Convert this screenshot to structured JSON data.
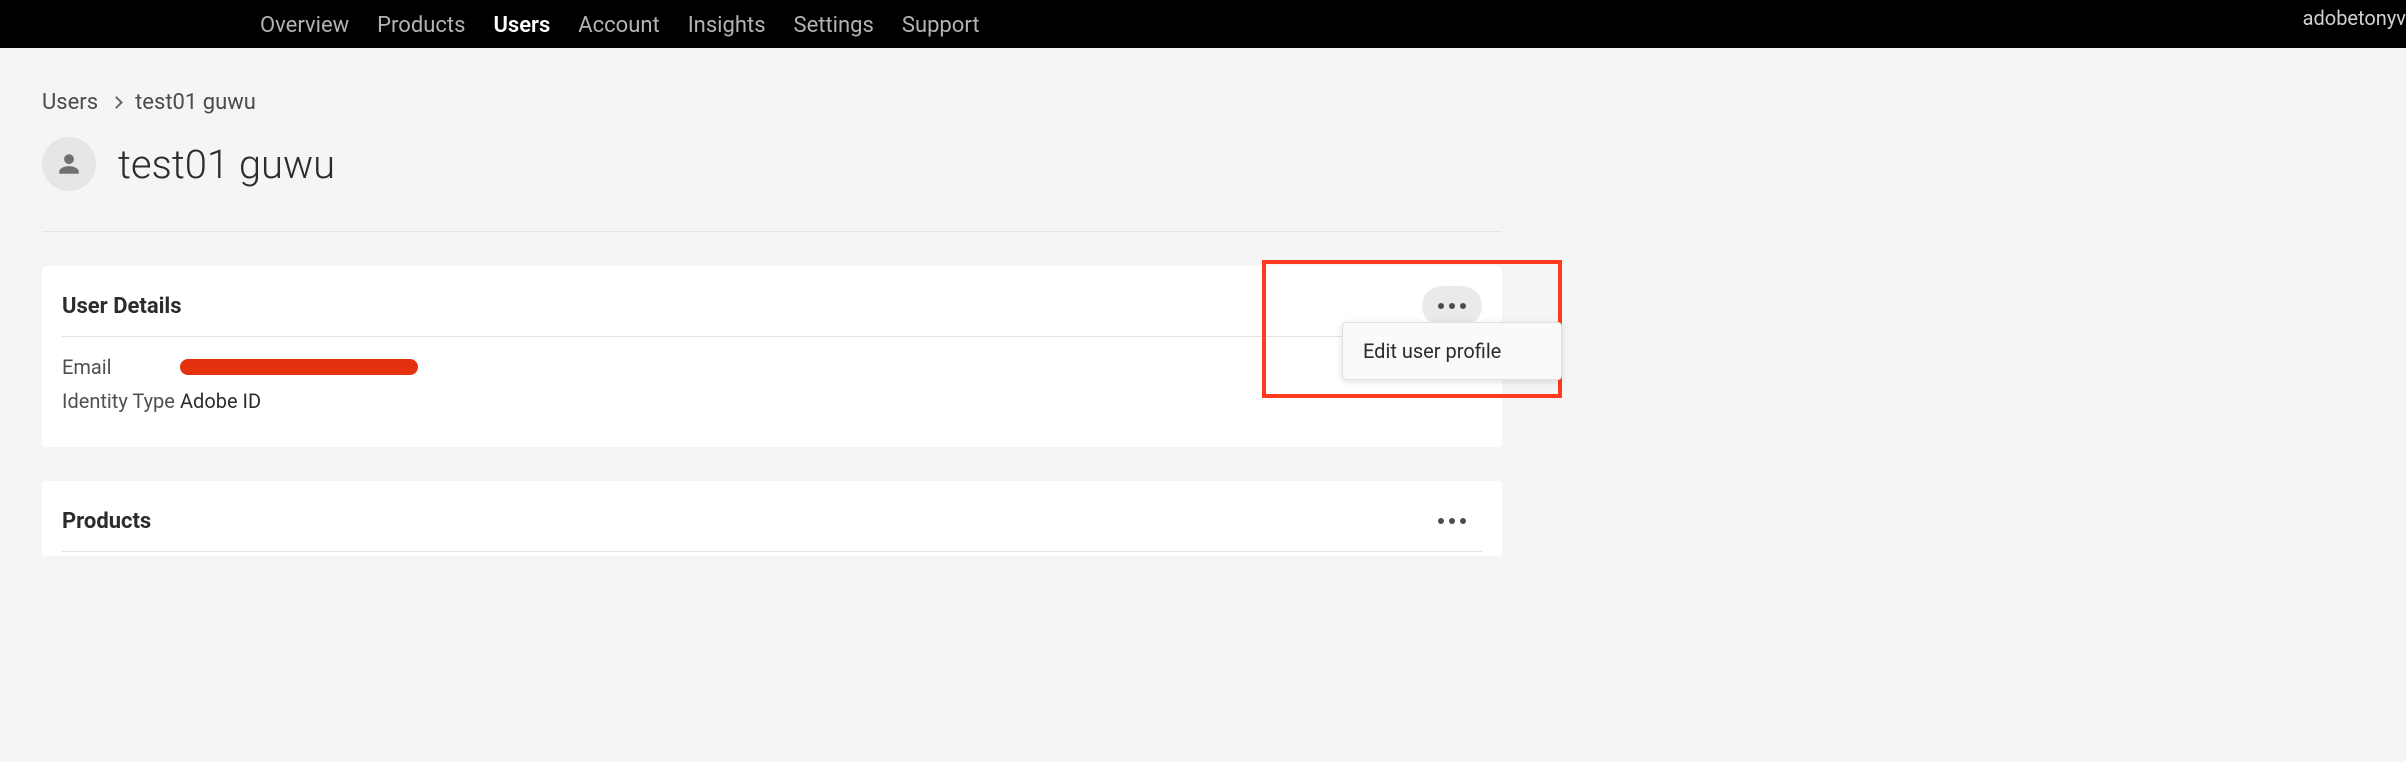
{
  "topnav": {
    "items": [
      {
        "label": "Overview",
        "active": false
      },
      {
        "label": "Products",
        "active": false
      },
      {
        "label": "Users",
        "active": true
      },
      {
        "label": "Account",
        "active": false
      },
      {
        "label": "Insights",
        "active": false
      },
      {
        "label": "Settings",
        "active": false
      },
      {
        "label": "Support",
        "active": false
      }
    ],
    "user_label": "adobetonyv"
  },
  "breadcrumb": {
    "root": "Users",
    "current": "test01 guwu"
  },
  "page_title": "test01 guwu",
  "user_details": {
    "section_title": "User Details",
    "fields": {
      "email_label": "Email",
      "email_value_redacted": true,
      "identity_type_label": "Identity Type",
      "identity_type_value": "Adobe ID"
    },
    "menu": {
      "edit_label": "Edit user profile"
    }
  },
  "products": {
    "section_title": "Products"
  }
}
